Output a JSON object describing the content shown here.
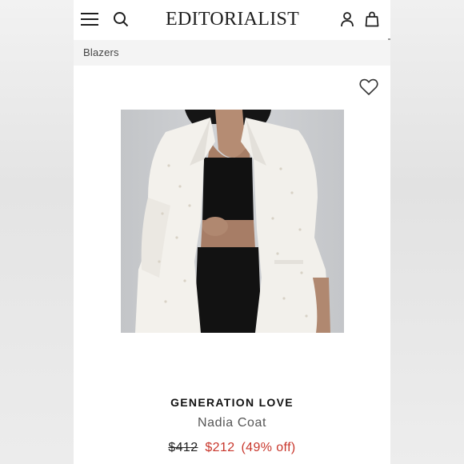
{
  "header": {
    "logo_text": "EDITORIALIST",
    "icons": [
      "menu-icon",
      "search-icon",
      "account-icon",
      "shopping-bag-icon"
    ]
  },
  "breadcrumb": {
    "label": "Blazers"
  },
  "product": {
    "image_alt_icon": "product-photo",
    "wishlist_icon": "heart-icon",
    "brand": "GENERATION LOVE",
    "name": "Nadia Coat",
    "original_price": "$412",
    "sale_price": "$212",
    "discount": "(49% off)"
  },
  "colors": {
    "sale": "#c8362b",
    "text": "#111111",
    "breadcrumb_bg": "#f4f4f4"
  }
}
